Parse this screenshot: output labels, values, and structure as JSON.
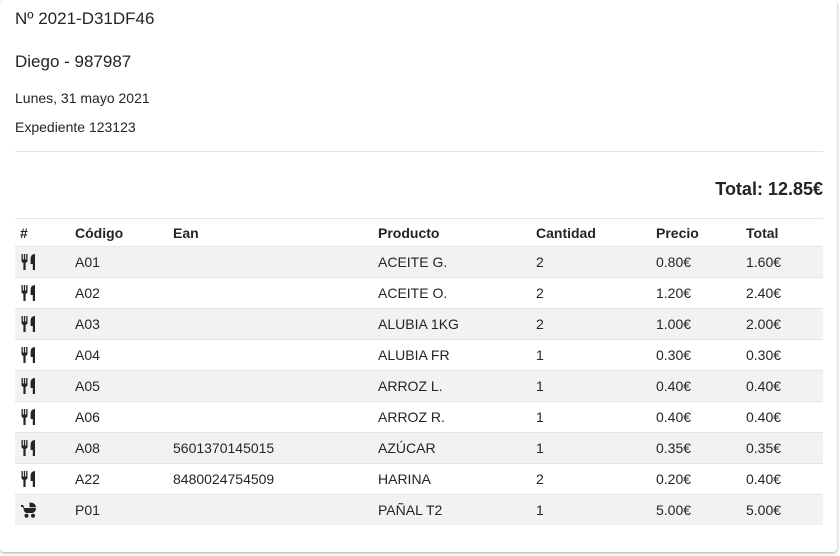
{
  "header": {
    "order_number": "Nº 2021-D31DF46",
    "client": "Diego - 987987",
    "date": "Lunes, 31 mayo 2021",
    "expediente": "Expediente 123123"
  },
  "summary": {
    "total": "Total: 12.85€"
  },
  "table": {
    "columns": [
      "#",
      "Código",
      "Ean",
      "Producto",
      "Cantidad",
      "Precio",
      "Total"
    ],
    "rows": [
      {
        "icon": "cutlery-icon",
        "codigo": "A01",
        "ean": "",
        "producto": "ACEITE G.",
        "cantidad": "2",
        "precio": "0.80€",
        "total": "1.60€"
      },
      {
        "icon": "cutlery-icon",
        "codigo": "A02",
        "ean": "",
        "producto": "ACEITE O.",
        "cantidad": "2",
        "precio": "1.20€",
        "total": "2.40€"
      },
      {
        "icon": "cutlery-icon",
        "codigo": "A03",
        "ean": "",
        "producto": "ALUBIA 1KG",
        "cantidad": "2",
        "precio": "1.00€",
        "total": "2.00€"
      },
      {
        "icon": "cutlery-icon",
        "codigo": "A04",
        "ean": "",
        "producto": "ALUBIA FR",
        "cantidad": "1",
        "precio": "0.30€",
        "total": "0.30€"
      },
      {
        "icon": "cutlery-icon",
        "codigo": "A05",
        "ean": "",
        "producto": "ARROZ L.",
        "cantidad": "1",
        "precio": "0.40€",
        "total": "0.40€"
      },
      {
        "icon": "cutlery-icon",
        "codigo": "A06",
        "ean": "",
        "producto": "ARROZ R.",
        "cantidad": "1",
        "precio": "0.40€",
        "total": "0.40€"
      },
      {
        "icon": "cutlery-icon",
        "codigo": "A08",
        "ean": "5601370145015",
        "producto": "AZÚCAR",
        "cantidad": "1",
        "precio": "0.35€",
        "total": "0.35€"
      },
      {
        "icon": "cutlery-icon",
        "codigo": "A22",
        "ean": "8480024754509",
        "producto": "HARINA",
        "cantidad": "2",
        "precio": "0.20€",
        "total": "0.40€"
      },
      {
        "icon": "baby-carriage-icon",
        "codigo": "P01",
        "ean": "",
        "producto": "PAÑAL T2",
        "cantidad": "1",
        "precio": "5.00€",
        "total": "5.00€"
      }
    ]
  }
}
